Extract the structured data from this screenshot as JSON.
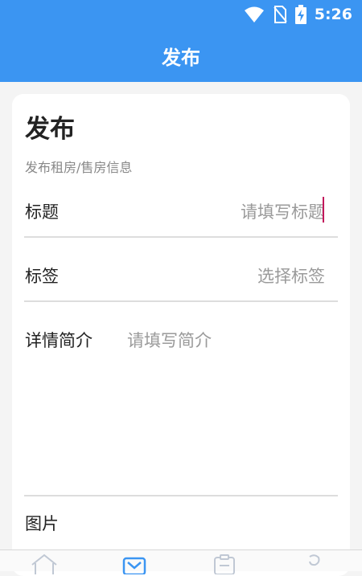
{
  "status_bar": {
    "time": "5:26",
    "icons": [
      "wifi-icon",
      "sim-no-signal-icon",
      "battery-charging-icon"
    ]
  },
  "app_bar": {
    "title": "发布"
  },
  "card": {
    "title": "发布",
    "subtitle": "发布租房/售房信息",
    "title_field": {
      "label": "标题",
      "placeholder": "请填写标题"
    },
    "tags_field": {
      "label": "标签",
      "placeholder": "选择标签"
    },
    "detail_field": {
      "label": "详情简介",
      "placeholder": "请填写简介"
    },
    "image_field": {
      "label": "图片"
    }
  },
  "bottom_nav": {
    "items": [
      "home-icon",
      "publish-icon",
      "list-icon",
      "profile-icon"
    ],
    "active_index": 1
  },
  "colors": {
    "primary": "#3b95f2",
    "cursor": "#c2185b",
    "background": "#f4f4f4"
  }
}
